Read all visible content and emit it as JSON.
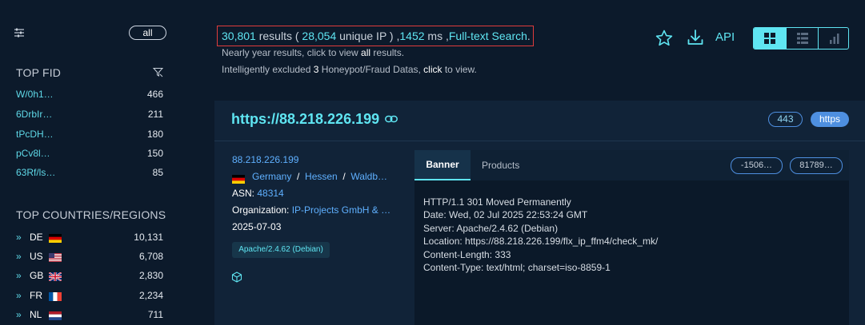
{
  "sidebar": {
    "all_label": "all",
    "top_fid_title": "TOP FID",
    "fids": [
      {
        "key": "W/0h1…",
        "count": "466"
      },
      {
        "key": "6DrbIr…",
        "count": "211"
      },
      {
        "key": "tPcDH…",
        "count": "180"
      },
      {
        "key": "pCv8l…",
        "count": "150"
      },
      {
        "key": "63Rf/ls…",
        "count": "85"
      }
    ],
    "countries_title": "TOP COUNTRIES/REGIONS",
    "countries": [
      {
        "code": "DE",
        "count": "10,131",
        "flag": "de-flag"
      },
      {
        "code": "US",
        "count": "6,708",
        "flag": "us-flag"
      },
      {
        "code": "GB",
        "count": "2,830",
        "flag": "gb-flag"
      },
      {
        "code": "FR",
        "count": "2,234",
        "flag": "fr-flag"
      },
      {
        "code": "NL",
        "count": "711",
        "flag": "nl-flag"
      }
    ]
  },
  "header": {
    "results_count": "30,801",
    "results_word": " results ( ",
    "unique_count": "28,054",
    "unique_word": " unique IP ) ,",
    "ms_value": "1452",
    "ms_word": " ms ,",
    "mode": "Full-text Search",
    "period": ".",
    "line2_prefix": "Nearly year results, click to view ",
    "line2_link": "all",
    "line2_suffix": " results.",
    "line3_prefix": "Intelligently excluded ",
    "line3_count": "3",
    "line3_mid": " Honeypot/Fraud Datas, ",
    "line3_link": "click",
    "line3_suffix": " to view.",
    "api_label": "API"
  },
  "result": {
    "url": "https://88.218.226.199",
    "port": "443",
    "protocol": "https",
    "ip": "88.218.226.199",
    "country": "Germany",
    "sep": "/",
    "region": "Hessen",
    "city": "Waldb…",
    "asn_label": "ASN:",
    "asn": "48314",
    "org_label": "Organization:",
    "org": "IP-Projects GmbH & …",
    "date": "2025-07-03",
    "server_tag": "Apache/2.4.62 (Debian)",
    "tabs": [
      "Banner",
      "Products"
    ],
    "hash1": "-1506…",
    "hash2": "81789…",
    "banner_lines": [
      "HTTP/1.1 301 Moved Permanently",
      "Date: Wed, 02 Jul 2025 22:53:24 GMT",
      "Server: Apache/2.4.62 (Debian)",
      "Location: https://88.218.226.199/flx_ip_ffm4/check_mk/",
      "Content-Length: 333",
      "Content-Type: text/html; charset=iso-8859-1"
    ]
  },
  "colors": {
    "background": "#0c1a2b",
    "accent": "#5fe5f2",
    "link": "#5fb0ff",
    "highlight_border": "#e03c3c"
  }
}
